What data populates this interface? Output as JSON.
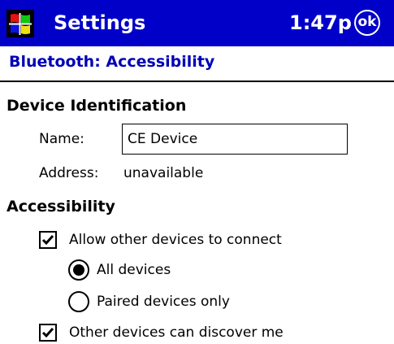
{
  "titlebar": {
    "start_icon": "windows-flag-icon",
    "app_title": "Settings",
    "clock": "1:47p",
    "ok_label": "ok",
    "background": "#0000c8"
  },
  "page_header": {
    "title": "Bluetooth: Accessibility",
    "color": "#0000b8"
  },
  "device_identification": {
    "title": "Device Identification",
    "name_label": "Name:",
    "name_value": "CE Device",
    "address_label": "Address:",
    "address_value": "unavailable"
  },
  "accessibility": {
    "title": "Accessibility",
    "allow_connect": {
      "label": "Allow other devices to connect",
      "checked": true
    },
    "connect_options": [
      {
        "label": "All devices",
        "selected": true
      },
      {
        "label": "Paired devices only",
        "selected": false
      }
    ],
    "discoverable": {
      "label": "Other devices can discover me",
      "checked": true
    }
  }
}
